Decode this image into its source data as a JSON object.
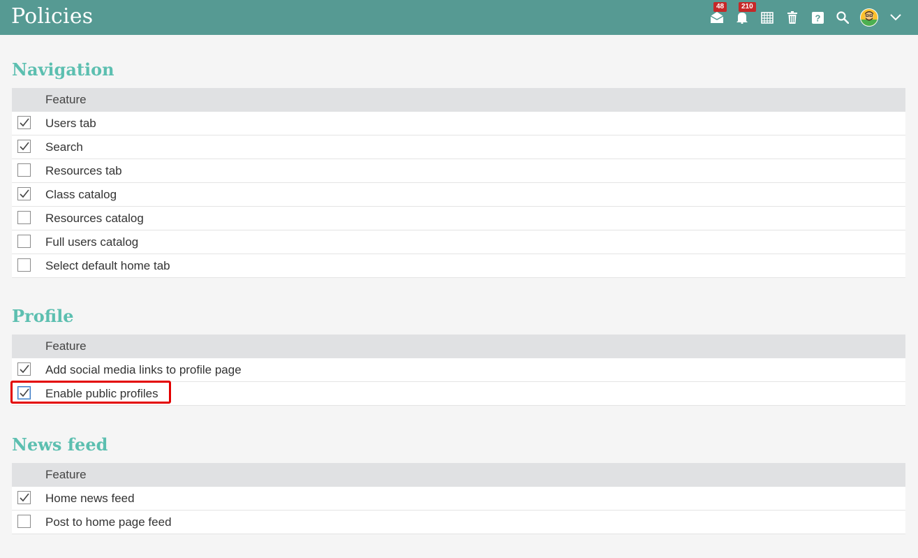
{
  "header": {
    "title": "Policies",
    "mail_badge": "48",
    "notifications_badge": "210",
    "icons": [
      "mail-icon",
      "bell-icon",
      "calendar-icon",
      "trash-icon",
      "help-icon",
      "search-icon",
      "avatar",
      "chevron-down-icon"
    ]
  },
  "colors": {
    "header_bg": "#569a93",
    "section_title": "#5cbfb0",
    "badge": "#c62828",
    "highlight": "#e30000"
  },
  "sections": {
    "navigation": {
      "title": "Navigation",
      "column": "Feature",
      "rows": [
        {
          "label": "Users tab",
          "checked": true
        },
        {
          "label": "Search",
          "checked": true
        },
        {
          "label": "Resources tab",
          "checked": false
        },
        {
          "label": "Class catalog",
          "checked": true
        },
        {
          "label": "Resources catalog",
          "checked": false
        },
        {
          "label": "Full users catalog",
          "checked": false
        },
        {
          "label": "Select default home tab",
          "checked": false
        }
      ]
    },
    "profile": {
      "title": "Profile",
      "column": "Feature",
      "rows": [
        {
          "label": "Add social media links to profile page",
          "checked": true
        },
        {
          "label": "Enable public profiles",
          "checked": true
        }
      ]
    },
    "news_feed": {
      "title": "News feed",
      "column": "Feature",
      "rows": [
        {
          "label": "Home news feed",
          "checked": true
        },
        {
          "label": "Post to home page feed",
          "checked": false
        }
      ]
    }
  }
}
